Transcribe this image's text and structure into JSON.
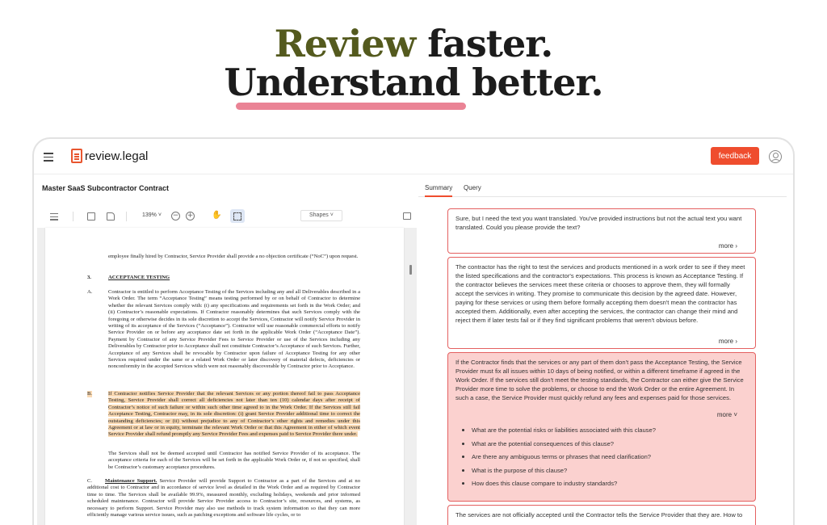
{
  "hero": {
    "line1_highlight": "Review",
    "line1_rest": "faster.",
    "line2": "Understand better."
  },
  "app": {
    "logo_text": "review.legal",
    "feedback_label": "feedback",
    "doc_title": "Master SaaS Subcontractor Contract",
    "tabs": [
      {
        "label": "Summary",
        "active": true
      },
      {
        "label": "Query",
        "active": false
      }
    ]
  },
  "pdf_toolbar": {
    "zoom": "139%",
    "shapes_label": "Shapes"
  },
  "pdf": {
    "para_top": "employee finally hired by Contractor, Service Provider shall provide a no objection certificate (“NoC”) upon request.",
    "sec3_num": "3.",
    "sec3_title": "ACCEPTANCE TESTING",
    "a_label": "A.",
    "a_text": "Contractor is entitled to perform Acceptance Testing of the Services including any and all Deliverables described in a Work Order. The term “Acceptance Testing” means testing performed by or on behalf of Contractor to determine whether the relevant Services comply with: (i) any specifications and requirements set forth in the Work Order; and (ii) Contractor’s reasonable expectations. If Contractor reasonably determines that such Services comply with the foregoing or otherwise decides in its sole discretion to accept the Services, Contractor will notify Service Provider in writing of its acceptance of the Services (“Acceptance”). Contractor will use reasonable commercial efforts to notify Service Provider on or before any acceptance date set forth in the applicable Work Order (“Acceptance Date”). Payment by Contractor of any Service Provider Fees to Service Provider or use of the Services including any Deliverables by Contractor prior to Acceptance shall not constitute Contractor’s Acceptance of such Services. Further, Acceptance of any Services shall be revocable by Contractor upon failure of Acceptance Testing for any other Services required under the same or a related Work Order or later discovery of material defects, deficiencies or nonconformity in the accepted Services which were not reasonably discoverable by Contractor prior to Acceptance.",
    "b_label": "B.",
    "b_text": "If Contractor notifies Service Provider that the relevant Services or any portion thereof fail to pass Acceptance Testing, Service Provider shall correct all deficiencies not later than ten (10) calendar days after receipt of Contractor’s notice of such failure or within such other time agreed to in the Work Order. If the Services still fail Acceptance Testing, Contractor may, in its sole discretion: (i) grant Service Provider additional time to correct the outstanding deficiencies; or (ii) without prejudice to any of Contractor’s other rights and remedies under this Agreement or at law or in equity, terminate the relevant Work Order or that this Agreement in either of which event Service Provider shall refund promptly any Service Provider Fees and expenses paid to Service Provider there under.",
    "b_after": "The Services shall not be deemed accepted until Contractor has notified Service Provider of its acceptance. The acceptance criteria for each of the Services will be set forth in the applicable Work Order or, if not so specified, shall be Contractor’s customary acceptance procedures.",
    "c_label": "C.",
    "c_title": "Maintenance Support.",
    "c_text": "Service Provider will provide Support to Contractor as a part of the Services and at no additional cost to Contractor and in accordance of service level as detailed in the Work Order and as required by Contractor time to time. The Services shall be available 99.9%, measured monthly, excluding holidays, weekends and prior informed scheduled maintenance. Contractor will provide Service Provider access to Contractor’s site, resources, and systems, as necessary to perform Support. Service Provider may also use methods to track system information so that they can more efficiently manage various service issues, such as patching exceptions and software life cycles, or to"
  },
  "summary_cards": [
    {
      "text": "Sure, but I need the text you want translated. You've provided instructions but not the actual text you want translated. Could you please provide the text?",
      "more": "more"
    },
    {
      "text": "The contractor has the right to test the services and products mentioned in a work order to see if they meet the listed specifications and the contractor's expectations. This process is known as Acceptance Testing. If the contractor believes the services meet these criteria or chooses to approve them, they will formally accept the services in writing. They promise to communicate this decision by the agreed date. However, paying for these services or using them before formally accepting them doesn't mean the contractor has accepted them. Additionally, even after accepting the services, the contractor can change their mind and reject them if later tests fail or if they find significant problems that weren't obvious before.",
      "more": "more"
    },
    {
      "text": "If the Contractor finds that the services or any part of them don't pass the Acceptance Testing, the Service Provider must fix all issues within 10 days of being notified, or within a different timeframe if agreed in the Work Order. If the services still don't meet the testing standards, the Contractor can either give the Service Provider more time to solve the problems, or choose to end the Work Order or the entire Agreement. In such a case, the Service Provider must quickly refund any fees and expenses paid for those services.",
      "more": "more",
      "questions": [
        "What are the potential risks or liabilities associated with this clause?",
        "What are the potential consequences of this clause?",
        "Are there any ambiguous terms or phrases that need clarification?",
        "What is the purpose of this clause?",
        "How does this clause compare to industry standards?"
      ]
    },
    {
      "text": "The services are not officially accepted until the Contractor tells the Service Provider that they are. How to"
    }
  ],
  "colors": {
    "accent": "#ef4d2e",
    "highlight_yellow": "#f3f28a",
    "highlight_pink": "#e8758a",
    "card_border": "#e46060",
    "card_active_bg": "#fbd1cf",
    "pdf_highlight": "#f9d9b3"
  }
}
